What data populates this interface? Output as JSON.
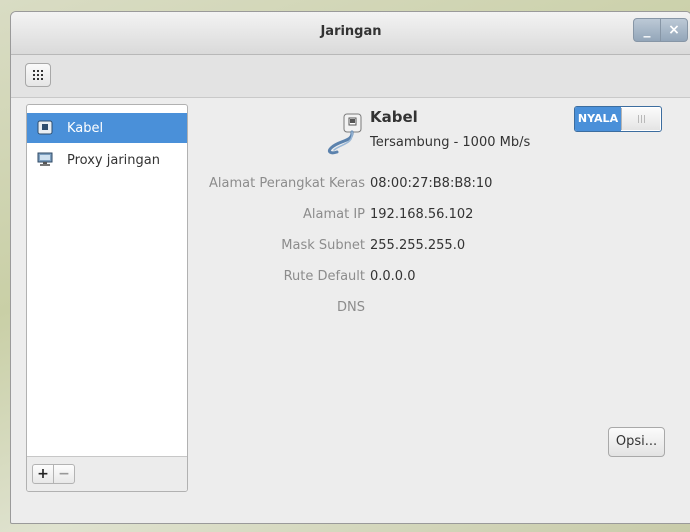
{
  "window": {
    "title": "Jaringan",
    "minimize_symbol": "_",
    "close_symbol": "×"
  },
  "toolbar": {
    "grid_icon": "grid-icon"
  },
  "sidebar": {
    "items": [
      {
        "label": "Kabel",
        "icon": "wired-network-icon",
        "selected": true
      },
      {
        "label": "Proxy jaringan",
        "icon": "proxy-computer-icon",
        "selected": false
      }
    ],
    "add_label": "+",
    "remove_label": "−"
  },
  "device": {
    "name": "Kabel",
    "status": "Tersambung - 1000 Mb/s",
    "toggle_label": "NYALA",
    "toggle_on": true
  },
  "properties": [
    {
      "label": "Alamat Perangkat Keras",
      "value": "08:00:27:B8:B8:10"
    },
    {
      "label": "Alamat IP",
      "value": "192.168.56.102"
    },
    {
      "label": "Mask Subnet",
      "value": "255.255.255.0"
    },
    {
      "label": "Rute Default",
      "value": "0.0.0.0"
    },
    {
      "label": "DNS",
      "value": ""
    }
  ],
  "options_button": "Opsi...",
  "colors": {
    "accent": "#4a90d9",
    "label_gray": "#8c8c8c"
  }
}
